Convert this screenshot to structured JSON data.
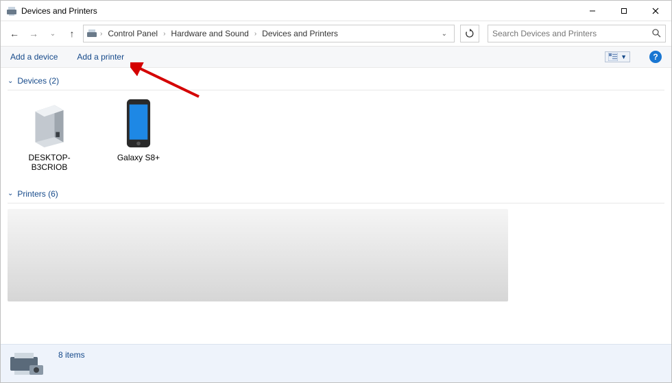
{
  "window": {
    "title": "Devices and Printers"
  },
  "breadcrumbs": [
    "Control Panel",
    "Hardware and Sound",
    "Devices and Printers"
  ],
  "search": {
    "placeholder": "Search Devices and Printers"
  },
  "toolbar": {
    "add_device": "Add a device",
    "add_printer": "Add a printer"
  },
  "groups": {
    "devices": {
      "label": "Devices",
      "count": "2"
    },
    "printers": {
      "label": "Printers",
      "count": "6"
    }
  },
  "devices": [
    {
      "name": "DESKTOP-B3CRIOB"
    },
    {
      "name": "Galaxy S8+"
    }
  ],
  "status": {
    "items_text": "8 items"
  }
}
